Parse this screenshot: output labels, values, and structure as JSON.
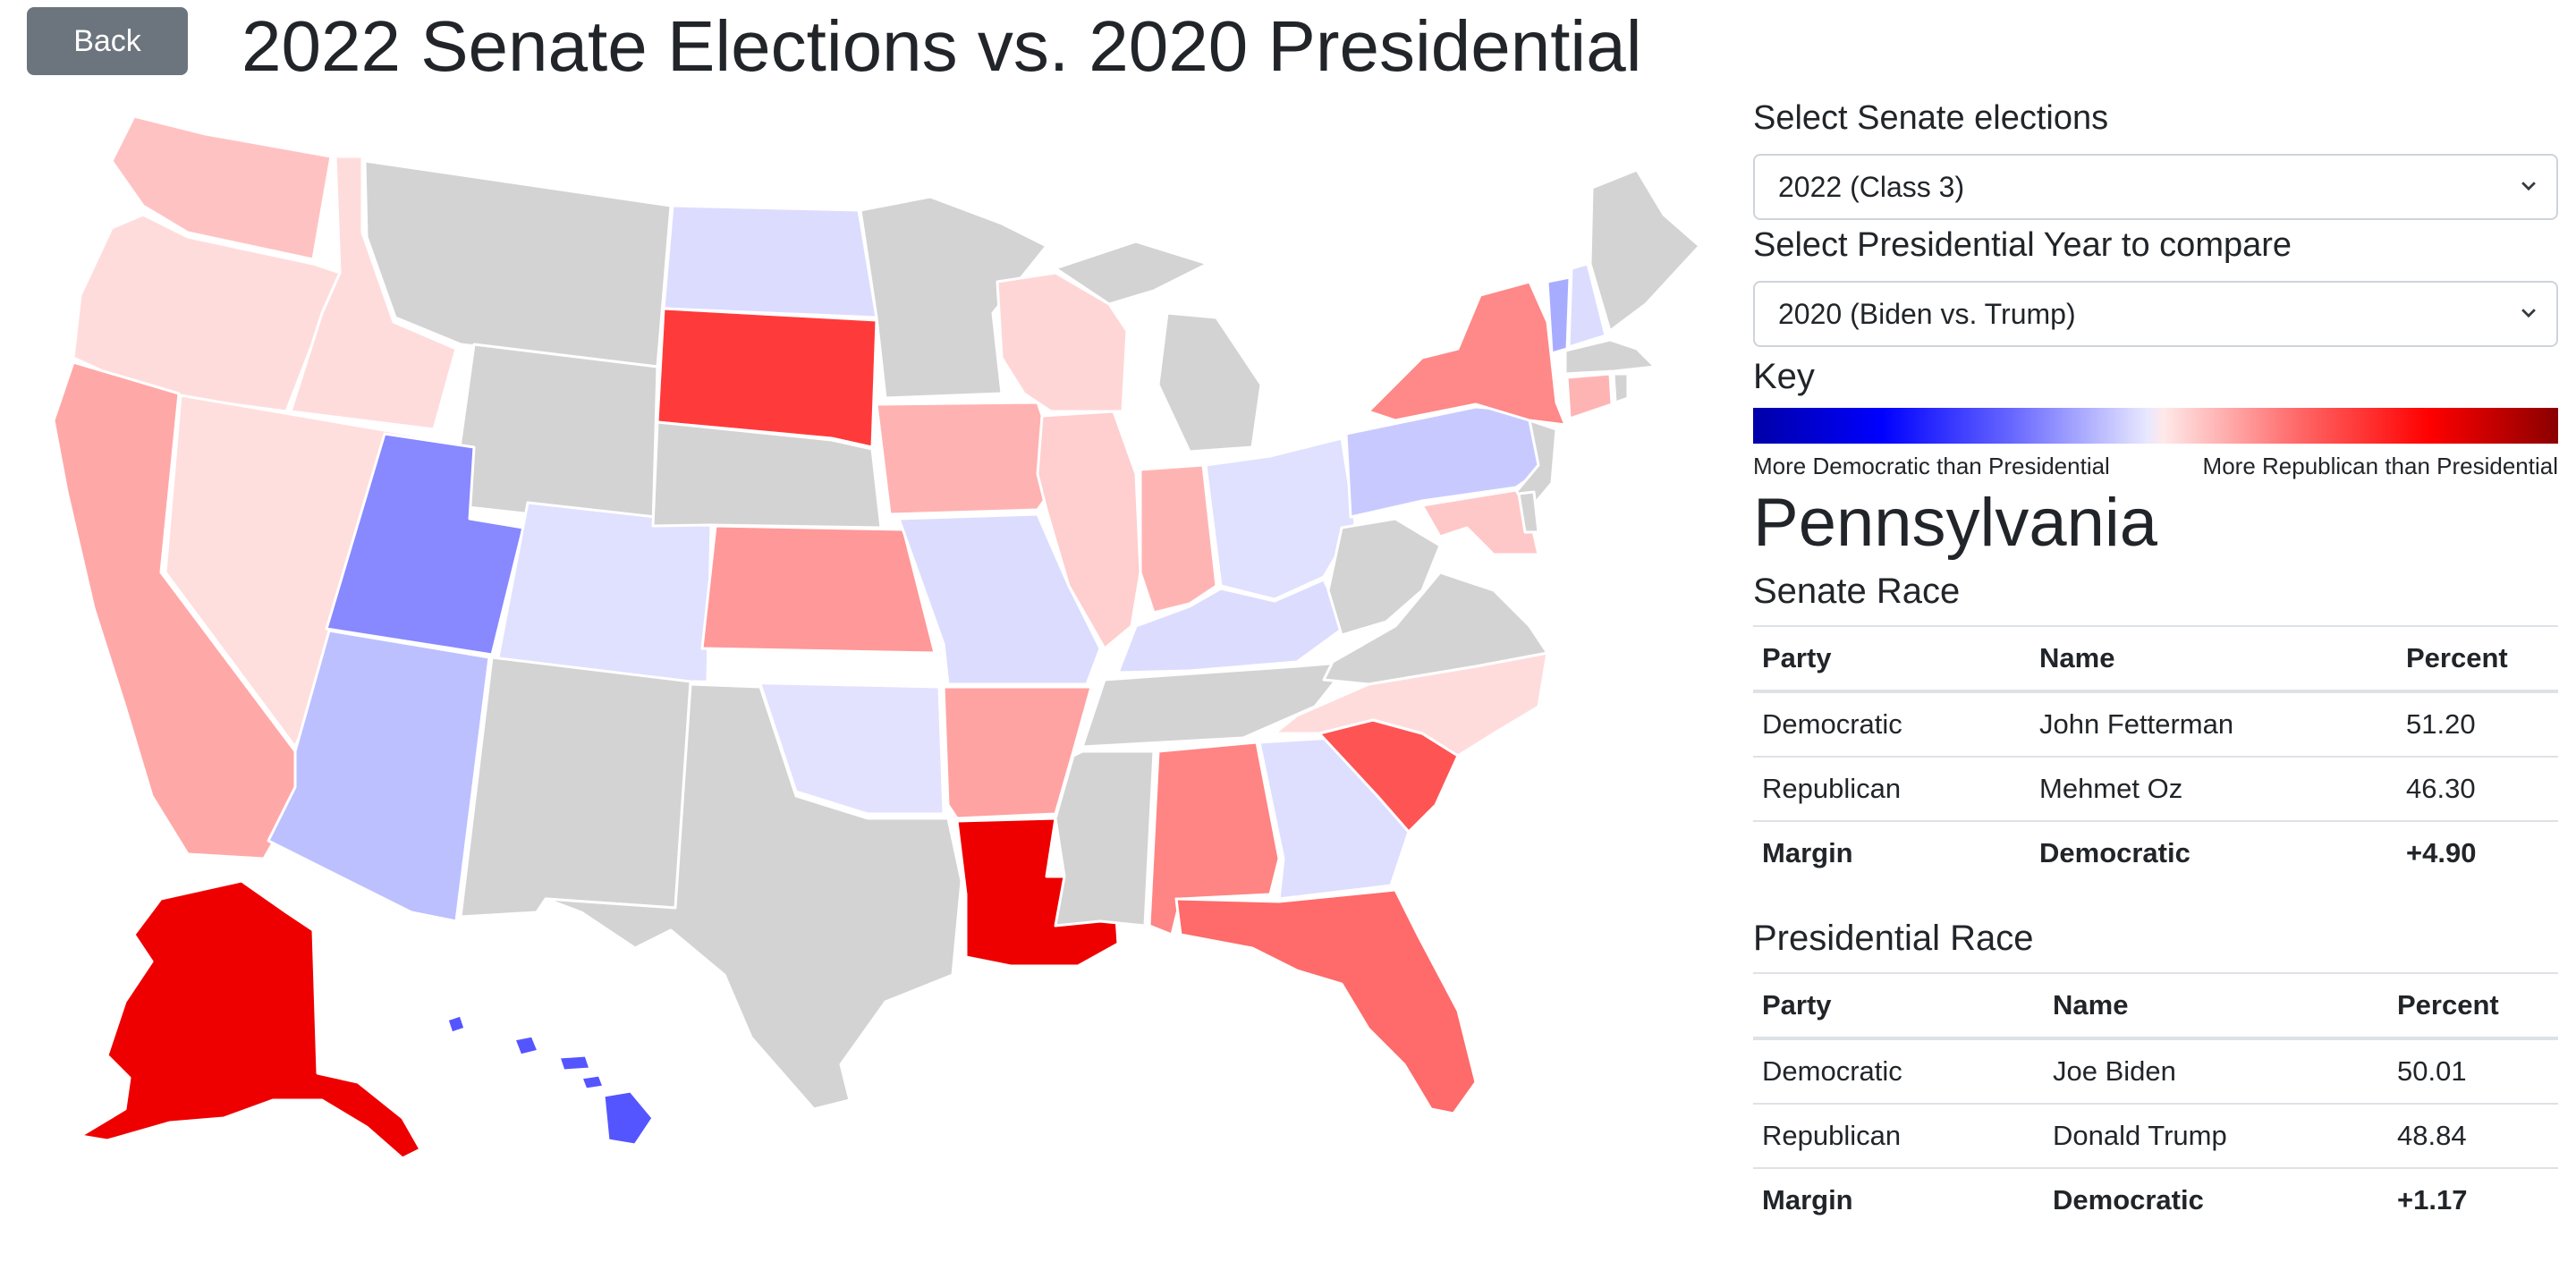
{
  "header": {
    "back_label": "Back",
    "title": "2022 Senate Elections vs. 2020 Presidential"
  },
  "controls": {
    "senate_label": "Select Senate elections",
    "senate_selected": "2022 (Class 3)",
    "pres_label": "Select Presidential Year to compare",
    "pres_selected": "2020 (Biden vs. Trump)"
  },
  "key": {
    "title": "Key",
    "left_label": "More Democratic than Presidential",
    "right_label": "More Republican than Presidential",
    "scale_colors": [
      "#0000a8",
      "#0000ff",
      "#e8e8ff",
      "#ffe8e8",
      "#ff0000",
      "#8a0000"
    ]
  },
  "selected_state": "Pennsylvania",
  "senate_race": {
    "title": "Senate Race",
    "columns": [
      "Party",
      "Name",
      "Percent"
    ],
    "rows": [
      {
        "party": "Democratic",
        "name": "John Fetterman",
        "percent": "51.20"
      },
      {
        "party": "Republican",
        "name": "Mehmet Oz",
        "percent": "46.30"
      }
    ],
    "margin": {
      "label": "Margin",
      "party": "Democratic",
      "value": "+4.90"
    }
  },
  "presidential_race": {
    "title": "Presidential Race",
    "columns": [
      "Party",
      "Name",
      "Percent"
    ],
    "rows": [
      {
        "party": "Democratic",
        "name": "Joe Biden",
        "percent": "50.01"
      },
      {
        "party": "Republican",
        "name": "Donald Trump",
        "percent": "48.84"
      }
    ],
    "margin": {
      "label": "Margin",
      "party": "Democratic",
      "value": "+1.17"
    }
  },
  "map": {
    "no_race_color": "#d3d3d3",
    "state_colors": {
      "WA": "#ffc2c2",
      "OR": "#ffdcdc",
      "CA": "#ffa8a8",
      "ID": "#ffdcdc",
      "NV": "#ffdede",
      "UT": "#8888ff",
      "AZ": "#bcc0ff",
      "CO": "#e0e0ff",
      "ND": "#dcdcff",
      "SD": "#ff3a3a",
      "KS": "#ff9898",
      "OK": "#e2e2ff",
      "IA": "#ffb2b2",
      "MO": "#dcdcff",
      "AR": "#ffa2a2",
      "LA": "#ee0000",
      "WI": "#ffd6d6",
      "IL": "#ffcece",
      "IN": "#ffb4b4",
      "OH": "#e0e0ff",
      "KY": "#dcdcff",
      "AL": "#ff8484",
      "GA": "#dedeff",
      "FL": "#ff6a6a",
      "SC": "#ff5454",
      "NC": "#ffdcdc",
      "PA": "#c8caff",
      "NY": "#ff8888",
      "VT": "#a8acff",
      "NH": "#dcdcff",
      "CT": "#ffb4b4",
      "MD": "#ffc8c8",
      "AK": "#ee0000",
      "HI": "#5555ff"
    }
  }
}
